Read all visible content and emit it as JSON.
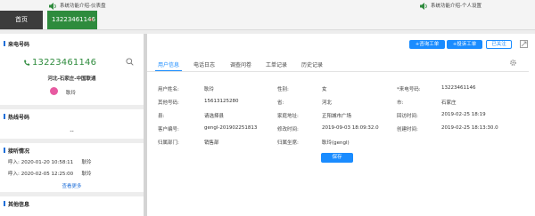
{
  "tabs": {
    "home_label": "首页",
    "active_label": "13223461146",
    "close_glyph": "×"
  },
  "notices": [
    "系统功能介绍-仪表盘",
    "系统功能介绍-个人设置"
  ],
  "caller": {
    "section_title": "来电号码",
    "number": "13223461146",
    "location": "河北-石家庄-中国联通",
    "name": "耿玲"
  },
  "hotline": {
    "section_title": "热线号码",
    "value": "--"
  },
  "recent_calls": {
    "section_title": "接听情况",
    "rows": [
      {
        "type": "呼入:",
        "time": "2020-01-20 10:58:11",
        "agent": "耿玲"
      },
      {
        "type": "呼入:",
        "time": "2020-02-05 12:25:00",
        "agent": "耿玲"
      }
    ],
    "more_label": "查看更多"
  },
  "other_info": {
    "section_title": "其他信息"
  },
  "actions": {
    "consult_ticket": "+咨询工单",
    "complaint_ticket": "+投诉工单",
    "followed": "已关注"
  },
  "detail_tabs": [
    "用户信息",
    "电话日志",
    "调查问卷",
    "工单记录",
    "历史记录"
  ],
  "form": {
    "rows": [
      [
        {
          "label": "用户姓名:",
          "value": "耿玲"
        },
        {
          "label": "性别:",
          "value": "女"
        },
        {
          "label": "*来电号码:",
          "value": "13223461146"
        }
      ],
      [
        {
          "label": "其他号码:",
          "value": "15613125280"
        },
        {
          "label": "省:",
          "value": "河北"
        },
        {
          "label": "市:",
          "value": "石家庄"
        }
      ],
      [
        {
          "label": "县:",
          "value": "请选择县"
        },
        {
          "label": "家庭地址:",
          "value": "正阳城市广场"
        },
        {
          "label": "回访时间:",
          "value": "2019-02-25 18:19"
        }
      ],
      [
        {
          "label": "客户编号:",
          "value": "gengl-201902251813"
        },
        {
          "label": "修改时间:",
          "value": "2019-09-03 18:09:32.0"
        },
        {
          "label": "创建时间:",
          "value": "2019-02-25 18:13:30.0"
        }
      ],
      [
        {
          "label": "归属部门:",
          "value": "销售部"
        },
        {
          "label": "归属坐席:",
          "value": "耿玲(gengl)"
        }
      ]
    ],
    "save_label": "保存"
  },
  "colors": {
    "accent": "#1a8cff",
    "active_tab": "#2e8b3d",
    "close": "#e03535",
    "avatar": "#e75aa1"
  },
  "icons": [
    "speaker-icon",
    "phone-icon",
    "search-icon",
    "close-icon",
    "expand-icon",
    "gear-icon"
  ]
}
